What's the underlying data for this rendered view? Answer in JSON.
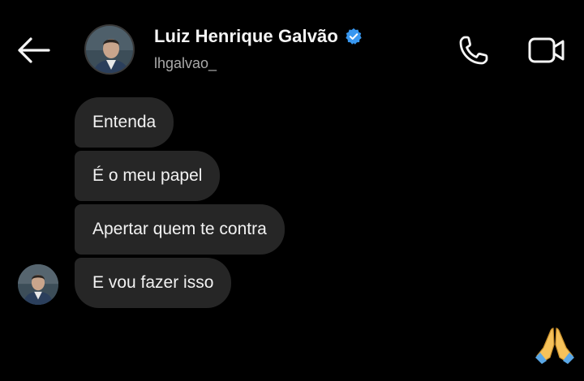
{
  "header": {
    "contact_name": "Luiz Henrique Galvão",
    "username": "lhgalvao_",
    "verified": true
  },
  "messages": [
    {
      "text": "Entenda"
    },
    {
      "text": "É o meu papel"
    },
    {
      "text": "Apertar quem te contra"
    },
    {
      "text": "E vou fazer isso"
    }
  ],
  "reaction": {
    "icon": "folded-hands-emoji"
  },
  "colors": {
    "background": "#000000",
    "bubble": "#262626",
    "verified_badge": "#3897f0",
    "text_primary": "#f2f2f2",
    "text_secondary": "#a9a9a9"
  },
  "icons": {
    "back": "arrow-left-icon",
    "call": "phone-icon",
    "video": "video-camera-icon"
  }
}
